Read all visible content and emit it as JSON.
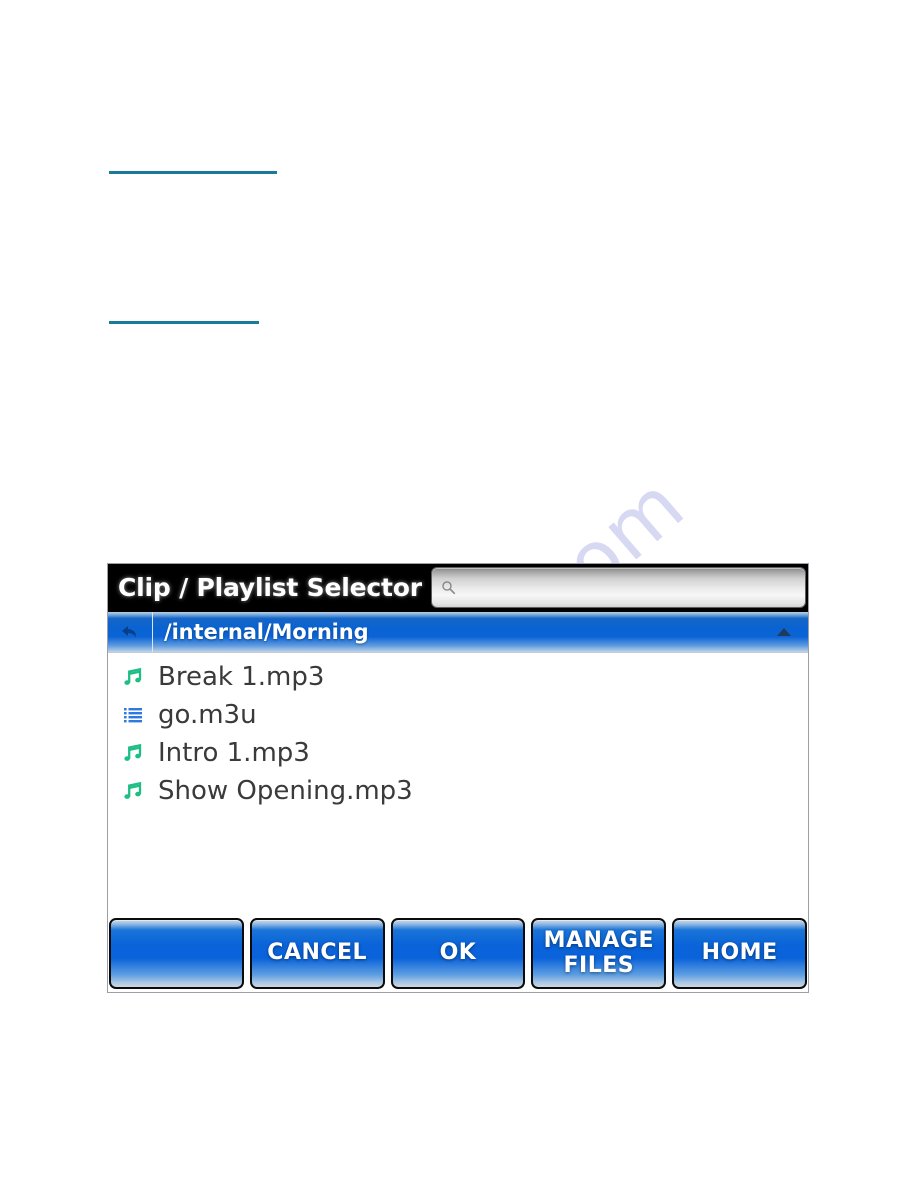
{
  "document": {
    "links": [
      {
        "name": "link-underline-upper",
        "text": ""
      },
      {
        "name": "link-underline-lower",
        "text": ""
      }
    ],
    "watermark": "manualshive.com"
  },
  "dialog": {
    "title": "Clip / Playlist Selector",
    "search": {
      "value": "",
      "placeholder": "",
      "icon": "search-icon"
    },
    "path_bar": {
      "path": "/internal/Morning",
      "back_icon": "back-arrow-icon",
      "scroll_up_icon": "triangle-up-icon"
    },
    "files": [
      {
        "name": "Break 1.mp3",
        "icon": "music-note-icon"
      },
      {
        "name": "go.m3u",
        "icon": "playlist-lines-icon"
      },
      {
        "name": "Intro 1.mp3",
        "icon": "music-note-icon"
      },
      {
        "name": "Show Opening.mp3",
        "icon": "music-note-icon"
      }
    ],
    "buttons": [
      {
        "label": "",
        "name": "blank-button"
      },
      {
        "label": "CANCEL",
        "name": "cancel-button"
      },
      {
        "label": "OK",
        "name": "ok-button"
      },
      {
        "label": "MANAGE\nFILES",
        "name": "manage-files-button"
      },
      {
        "label": "HOME",
        "name": "home-button"
      }
    ]
  },
  "colors": {
    "titlebar_bg": "#000000",
    "accent_blue": "#0a63d9",
    "music_icon_green": "#1fbe86",
    "playlist_icon_blue": "#2f7ae0",
    "link_teal": "#1b7a99",
    "watermark": "#c9cbee"
  }
}
